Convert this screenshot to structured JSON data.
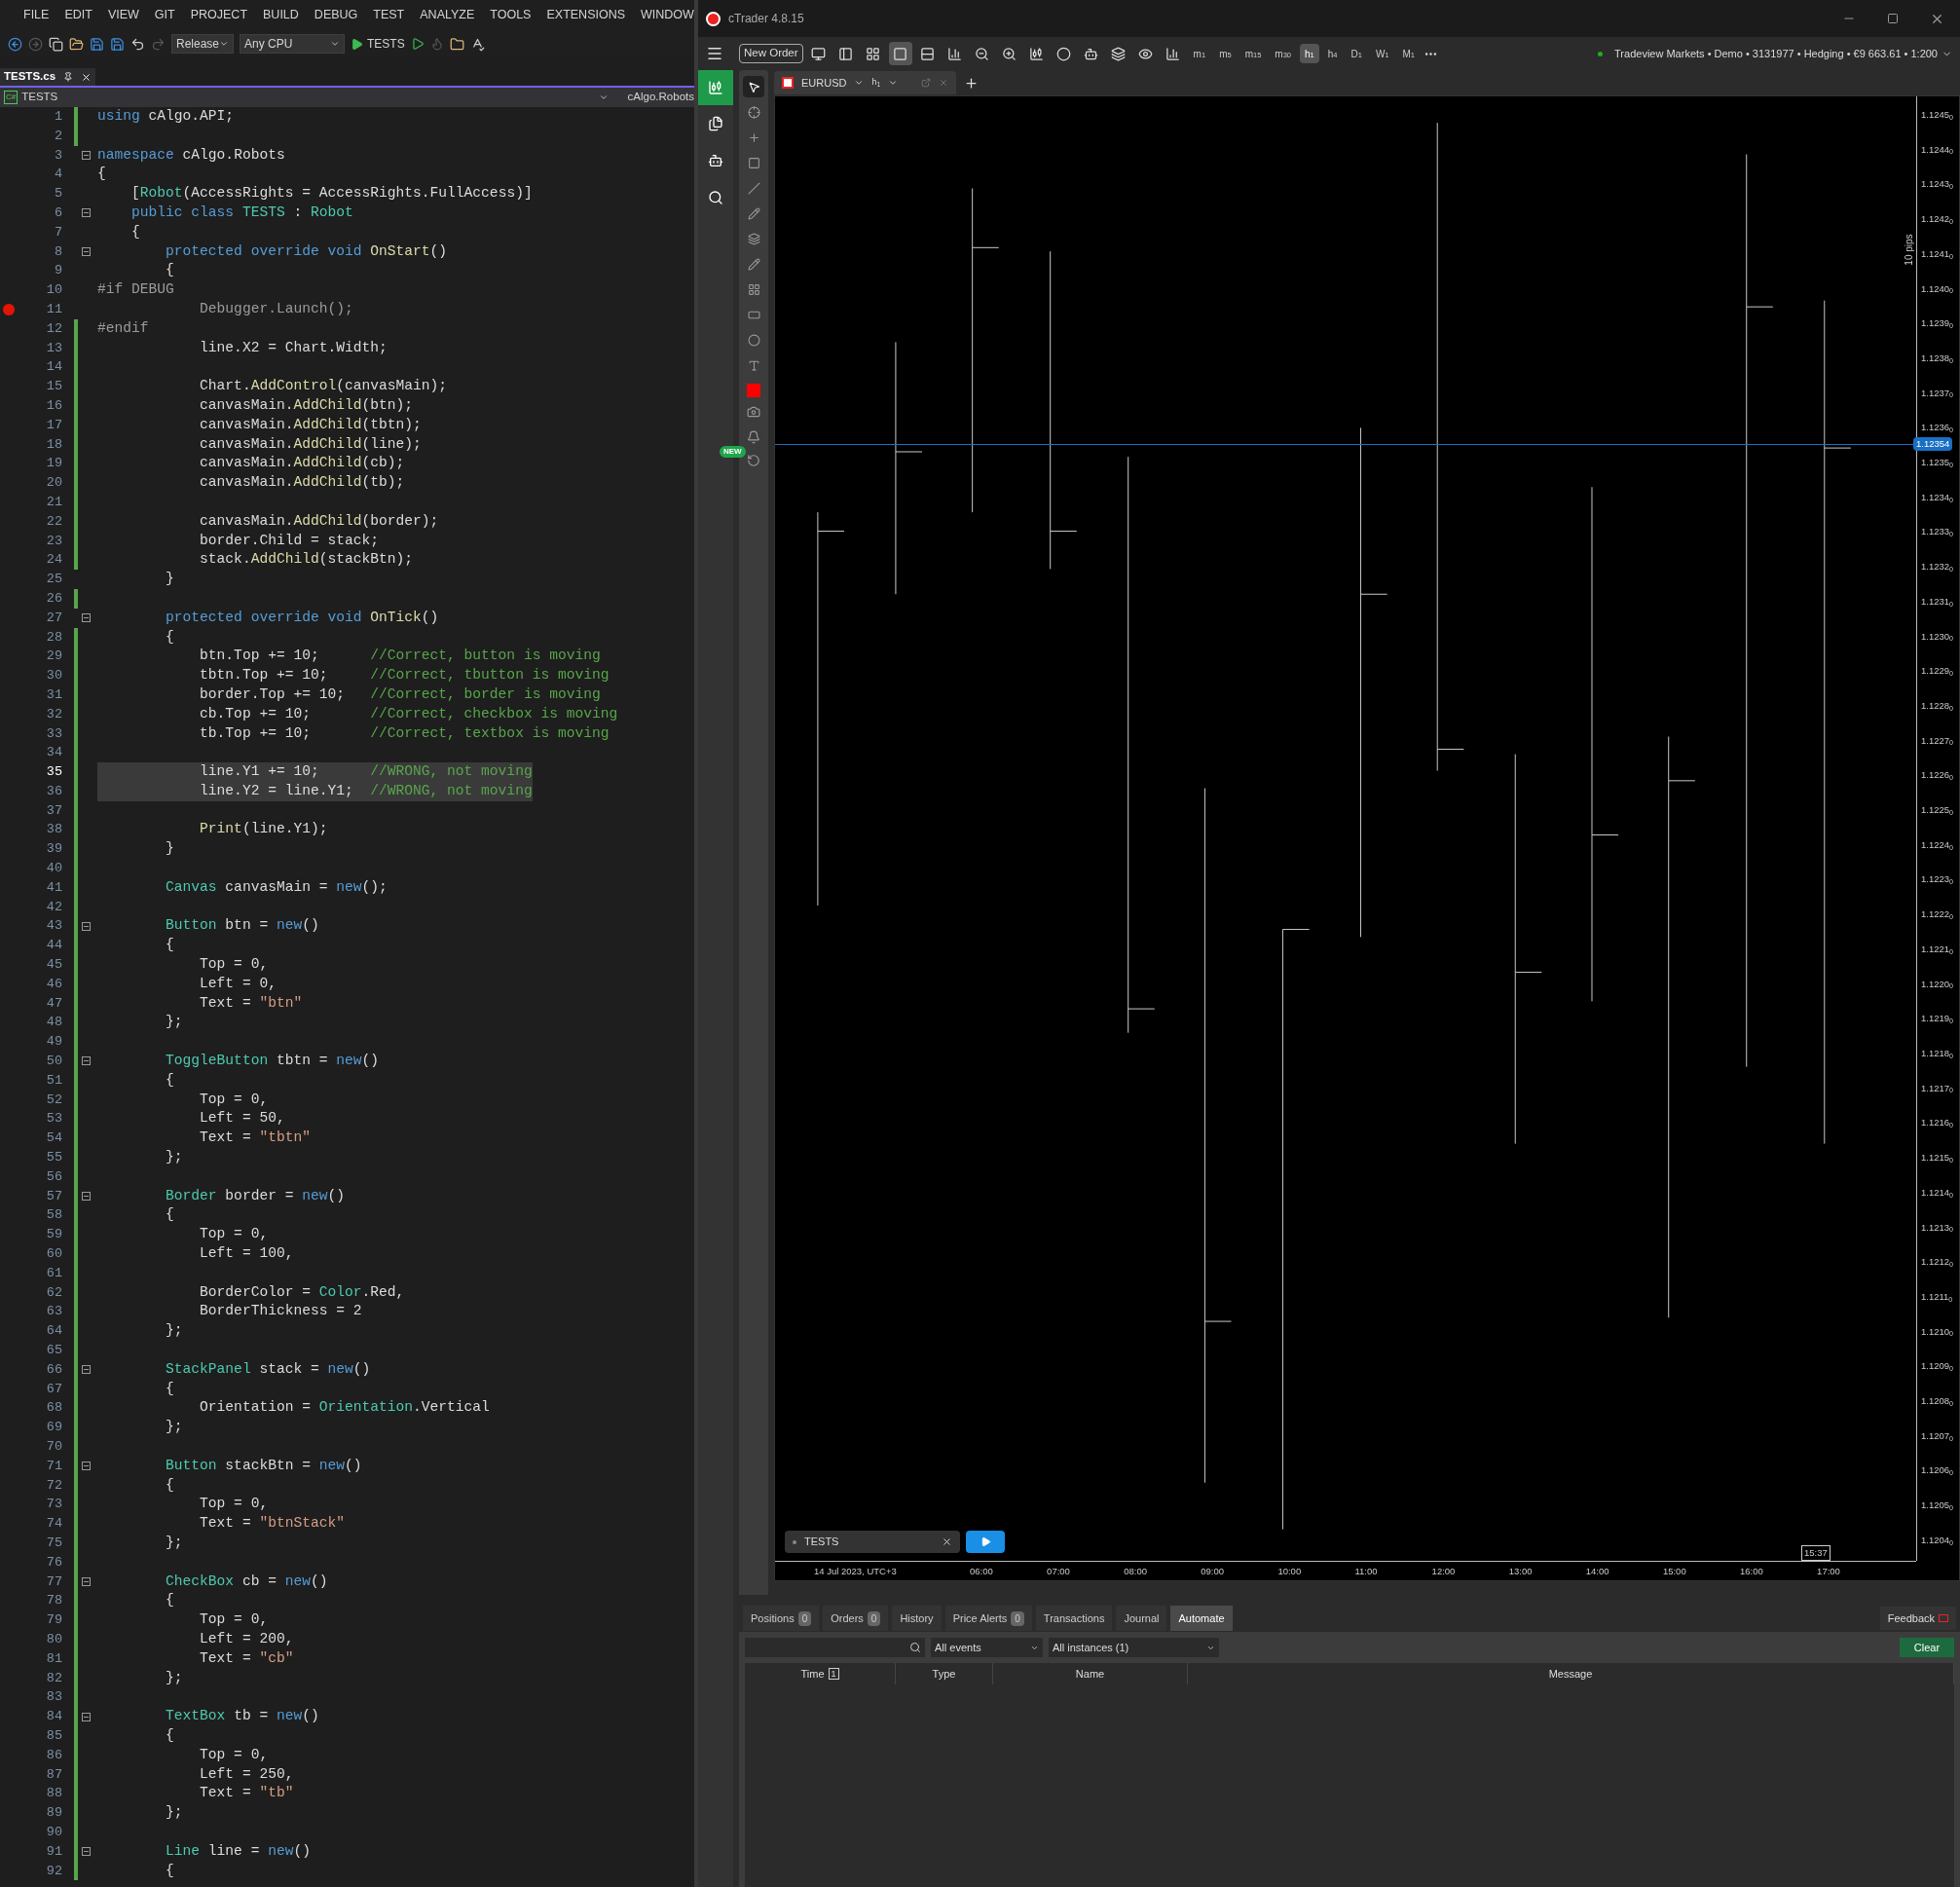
{
  "ide": {
    "menu": [
      "FILE",
      "EDIT",
      "VIEW",
      "GIT",
      "PROJECT",
      "BUILD",
      "DEBUG",
      "TEST",
      "ANALYZE",
      "TOOLS",
      "EXTENSIONS",
      "WINDOW"
    ],
    "toolbar": {
      "configuration": "Release",
      "platform": "Any CPU",
      "start": "TESTS"
    },
    "tab": {
      "label": "TESTS.cs",
      "selected": true
    },
    "nav": {
      "language": "C#",
      "project": "TESTS",
      "scope": "cAlgo.Robots"
    },
    "lines": [
      {
        "number": "1",
        "changed": true,
        "tokens": [
          {
            "kind": "kw",
            "text": "using"
          },
          {
            "kind": "plain",
            "text": " cAlgo.API;"
          }
        ]
      },
      {
        "number": "2",
        "changed": true
      },
      {
        "number": "3",
        "fold": true,
        "tokens": [
          {
            "kind": "kw",
            "text": "namespace"
          },
          {
            "kind": "plain",
            "text": " cAlgo.Robots"
          }
        ]
      },
      {
        "number": "4",
        "tokens": [
          {
            "kind": "plain",
            "text": "{"
          }
        ]
      },
      {
        "number": "5",
        "tokens": [
          {
            "kind": "plain",
            "text": "    ["
          },
          {
            "kind": "type",
            "text": "Robot"
          },
          {
            "kind": "plain",
            "text": "(AccessRights = AccessRights.FullAccess)]"
          }
        ]
      },
      {
        "number": "6",
        "fold": true,
        "tokens": [
          {
            "kind": "kw",
            "text": "    public class"
          },
          {
            "kind": "type",
            "text": " TESTS"
          },
          {
            "kind": "plain",
            "text": " : "
          },
          {
            "kind": "type",
            "text": "Robot"
          }
        ]
      },
      {
        "number": "7",
        "tokens": [
          {
            "kind": "plain",
            "text": "    {"
          }
        ]
      },
      {
        "number": "8",
        "fold": true,
        "tokens": [
          {
            "kind": "kw",
            "text": "        protected override void"
          },
          {
            "kind": "method",
            "text": " OnStart"
          },
          {
            "kind": "plain",
            "text": "()"
          }
        ]
      },
      {
        "number": "9",
        "tokens": [
          {
            "kind": "plain",
            "text": "        {"
          }
        ]
      },
      {
        "number": "10",
        "tokens": [
          {
            "kind": "inactive",
            "text": "#if DEBUG"
          }
        ]
      },
      {
        "number": "11",
        "breakpoint": true,
        "tokens": [
          {
            "kind": "inactive",
            "text": "            Debugger.Launch();"
          }
        ]
      },
      {
        "number": "12",
        "changed": true,
        "tokens": [
          {
            "kind": "inactive",
            "text": "#endif"
          }
        ]
      },
      {
        "number": "13",
        "changed": true,
        "tokens": [
          {
            "kind": "plain",
            "text": "            line.X2 = Chart.Width;"
          }
        ]
      },
      {
        "number": "14",
        "changed": true
      },
      {
        "number": "15",
        "changed": true,
        "tokens": [
          {
            "kind": "plain",
            "text": "            Chart."
          },
          {
            "kind": "method",
            "text": "AddControl"
          },
          {
            "kind": "plain",
            "text": "(canvasMain);"
          }
        ]
      },
      {
        "number": "16",
        "changed": true,
        "tokens": [
          {
            "kind": "plain",
            "text": "            canvasMain."
          },
          {
            "kind": "method",
            "text": "AddChild"
          },
          {
            "kind": "plain",
            "text": "(btn);"
          }
        ]
      },
      {
        "number": "17",
        "changed": true,
        "tokens": [
          {
            "kind": "plain",
            "text": "            canvasMain."
          },
          {
            "kind": "method",
            "text": "AddChild"
          },
          {
            "kind": "plain",
            "text": "(tbtn);"
          }
        ]
      },
      {
        "number": "18",
        "changed": true,
        "tokens": [
          {
            "kind": "plain",
            "text": "            canvasMain."
          },
          {
            "kind": "method",
            "text": "AddChild"
          },
          {
            "kind": "plain",
            "text": "(line);"
          }
        ]
      },
      {
        "number": "19",
        "changed": true,
        "tokens": [
          {
            "kind": "plain",
            "text": "            canvasMain."
          },
          {
            "kind": "method",
            "text": "AddChild"
          },
          {
            "kind": "plain",
            "text": "(cb);"
          }
        ]
      },
      {
        "number": "20",
        "changed": true,
        "tokens": [
          {
            "kind": "plain",
            "text": "            canvasMain."
          },
          {
            "kind": "method",
            "text": "AddChild"
          },
          {
            "kind": "plain",
            "text": "(tb);"
          }
        ]
      },
      {
        "number": "21",
        "changed": true
      },
      {
        "number": "22",
        "changed": true,
        "tokens": [
          {
            "kind": "plain",
            "text": "            canvasMain."
          },
          {
            "kind": "method",
            "text": "AddChild"
          },
          {
            "kind": "plain",
            "text": "(border);"
          }
        ]
      },
      {
        "number": "23",
        "changed": true,
        "tokens": [
          {
            "kind": "plain",
            "text": "            border.Child = stack;"
          }
        ]
      },
      {
        "number": "24",
        "changed": true,
        "tokens": [
          {
            "kind": "plain",
            "text": "            stack."
          },
          {
            "kind": "method",
            "text": "AddChild"
          },
          {
            "kind": "plain",
            "text": "(stackBtn);"
          }
        ]
      },
      {
        "number": "25",
        "tokens": [
          {
            "kind": "plain",
            "text": "        }"
          }
        ]
      },
      {
        "number": "26",
        "changed": true
      },
      {
        "number": "27",
        "fold": true,
        "tokens": [
          {
            "kind": "kw",
            "text": "        protected override void"
          },
          {
            "kind": "method",
            "text": " OnTick"
          },
          {
            "kind": "plain",
            "text": "()"
          }
        ]
      },
      {
        "number": "28",
        "changed": true,
        "tokens": [
          {
            "kind": "plain",
            "text": "        {"
          }
        ]
      },
      {
        "number": "29",
        "changed": true,
        "tokens": [
          {
            "kind": "plain",
            "text": "            btn.Top += 10;      "
          },
          {
            "kind": "comment",
            "text": "//Correct, button is moving"
          }
        ]
      },
      {
        "number": "30",
        "changed": true,
        "tokens": [
          {
            "kind": "plain",
            "text": "            tbtn.Top += 10;     "
          },
          {
            "kind": "comment",
            "text": "//Correct, tbutton is moving"
          }
        ]
      },
      {
        "number": "31",
        "changed": true,
        "tokens": [
          {
            "kind": "plain",
            "text": "            border.Top += 10;   "
          },
          {
            "kind": "comment",
            "text": "//Correct, border is moving"
          }
        ]
      },
      {
        "number": "32",
        "changed": true,
        "tokens": [
          {
            "kind": "plain",
            "text": "            cb.Top += 10;       "
          },
          {
            "kind": "comment",
            "text": "//Correct, checkbox is moving"
          }
        ]
      },
      {
        "number": "33",
        "changed": true,
        "tokens": [
          {
            "kind": "plain",
            "text": "            tb.Top += 10;       "
          },
          {
            "kind": "comment",
            "text": "//Correct, textbox is moving"
          }
        ]
      },
      {
        "number": "34",
        "changed": true
      },
      {
        "number": "35",
        "changed": true,
        "current": true,
        "highlighted": true,
        "tokens": [
          {
            "kind": "plain",
            "text": "            line.Y1 += 10;      "
          },
          {
            "kind": "comment",
            "text": "//WRONG, not moving"
          }
        ]
      },
      {
        "number": "36",
        "changed": true,
        "highlighted": true,
        "tokens": [
          {
            "kind": "plain",
            "text": "            line.Y2 = line.Y1;  "
          },
          {
            "kind": "comment",
            "text": "//WRONG, not moving"
          }
        ]
      },
      {
        "number": "37",
        "changed": true
      },
      {
        "number": "38",
        "changed": true,
        "tokens": [
          {
            "kind": "method",
            "text": "            Print"
          },
          {
            "kind": "plain",
            "text": "(line.Y1);"
          }
        ]
      },
      {
        "number": "39",
        "changed": true,
        "tokens": [
          {
            "kind": "plain",
            "text": "        }"
          }
        ]
      },
      {
        "number": "40",
        "changed": true
      },
      {
        "number": "41",
        "changed": true,
        "tokens": [
          {
            "kind": "type",
            "text": "        Canvas"
          },
          {
            "kind": "plain",
            "text": " canvasMain = "
          },
          {
            "kind": "kw",
            "text": "new"
          },
          {
            "kind": "plain",
            "text": "();"
          }
        ]
      },
      {
        "number": "42",
        "changed": true
      },
      {
        "number": "43",
        "changed": true,
        "fold": true,
        "tokens": [
          {
            "kind": "type",
            "text": "        Button"
          },
          {
            "kind": "plain",
            "text": " btn = "
          },
          {
            "kind": "kw",
            "text": "new"
          },
          {
            "kind": "plain",
            "text": "()"
          }
        ]
      },
      {
        "number": "44",
        "changed": true,
        "tokens": [
          {
            "kind": "plain",
            "text": "        {"
          }
        ]
      },
      {
        "number": "45",
        "changed": true,
        "tokens": [
          {
            "kind": "plain",
            "text": "            Top = 0,"
          }
        ]
      },
      {
        "number": "46",
        "changed": true,
        "tokens": [
          {
            "kind": "plain",
            "text": "            Left = 0,"
          }
        ]
      },
      {
        "number": "47",
        "changed": true,
        "tokens": [
          {
            "kind": "plain",
            "text": "            Text = "
          },
          {
            "kind": "string",
            "text": "\"btn\""
          }
        ]
      },
      {
        "number": "48",
        "changed": true,
        "tokens": [
          {
            "kind": "plain",
            "text": "        };"
          }
        ]
      },
      {
        "number": "49",
        "changed": true
      },
      {
        "number": "50",
        "changed": true,
        "fold": true,
        "tokens": [
          {
            "kind": "type",
            "text": "        ToggleButton"
          },
          {
            "kind": "plain",
            "text": " tbtn = "
          },
          {
            "kind": "kw",
            "text": "new"
          },
          {
            "kind": "plain",
            "text": "()"
          }
        ]
      },
      {
        "number": "51",
        "changed": true,
        "tokens": [
          {
            "kind": "plain",
            "text": "        {"
          }
        ]
      },
      {
        "number": "52",
        "changed": true,
        "tokens": [
          {
            "kind": "plain",
            "text": "            Top = 0,"
          }
        ]
      },
      {
        "number": "53",
        "changed": true,
        "tokens": [
          {
            "kind": "plain",
            "text": "            Left = 50,"
          }
        ]
      },
      {
        "number": "54",
        "changed": true,
        "tokens": [
          {
            "kind": "plain",
            "text": "            Text = "
          },
          {
            "kind": "string",
            "text": "\"tbtn\""
          }
        ]
      },
      {
        "number": "55",
        "changed": true,
        "tokens": [
          {
            "kind": "plain",
            "text": "        };"
          }
        ]
      },
      {
        "number": "56",
        "changed": true
      },
      {
        "number": "57",
        "changed": true,
        "fold": true,
        "tokens": [
          {
            "kind": "type",
            "text": "        Border"
          },
          {
            "kind": "plain",
            "text": " border = "
          },
          {
            "kind": "kw",
            "text": "new"
          },
          {
            "kind": "plain",
            "text": "()"
          }
        ]
      },
      {
        "number": "58",
        "changed": true,
        "tokens": [
          {
            "kind": "plain",
            "text": "        {"
          }
        ]
      },
      {
        "number": "59",
        "changed": true,
        "tokens": [
          {
            "kind": "plain",
            "text": "            Top = 0,"
          }
        ]
      },
      {
        "number": "60",
        "changed": true,
        "tokens": [
          {
            "kind": "plain",
            "text": "            Left = 100,"
          }
        ]
      },
      {
        "number": "61",
        "changed": true
      },
      {
        "number": "62",
        "changed": true,
        "tokens": [
          {
            "kind": "plain",
            "text": "            BorderColor = "
          },
          {
            "kind": "type",
            "text": "Color"
          },
          {
            "kind": "plain",
            "text": ".Red,"
          }
        ]
      },
      {
        "number": "63",
        "changed": true,
        "tokens": [
          {
            "kind": "plain",
            "text": "            BorderThickness = 2"
          }
        ]
      },
      {
        "number": "64",
        "changed": true,
        "tokens": [
          {
            "kind": "plain",
            "text": "        };"
          }
        ]
      },
      {
        "number": "65",
        "changed": true
      },
      {
        "number": "66",
        "changed": true,
        "fold": true,
        "tokens": [
          {
            "kind": "type",
            "text": "        StackPanel"
          },
          {
            "kind": "plain",
            "text": " stack = "
          },
          {
            "kind": "kw",
            "text": "new"
          },
          {
            "kind": "plain",
            "text": "()"
          }
        ]
      },
      {
        "number": "67",
        "changed": true,
        "tokens": [
          {
            "kind": "plain",
            "text": "        {"
          }
        ]
      },
      {
        "number": "68",
        "changed": true,
        "tokens": [
          {
            "kind": "plain",
            "text": "            Orientation = "
          },
          {
            "kind": "type",
            "text": "Orientation"
          },
          {
            "kind": "plain",
            "text": ".Vertical"
          }
        ]
      },
      {
        "number": "69",
        "changed": true,
        "tokens": [
          {
            "kind": "plain",
            "text": "        };"
          }
        ]
      },
      {
        "number": "70",
        "changed": true
      },
      {
        "number": "71",
        "changed": true,
        "fold": true,
        "tokens": [
          {
            "kind": "type",
            "text": "        Button"
          },
          {
            "kind": "plain",
            "text": " stackBtn = "
          },
          {
            "kind": "kw",
            "text": "new"
          },
          {
            "kind": "plain",
            "text": "()"
          }
        ]
      },
      {
        "number": "72",
        "changed": true,
        "tokens": [
          {
            "kind": "plain",
            "text": "        {"
          }
        ]
      },
      {
        "number": "73",
        "changed": true,
        "tokens": [
          {
            "kind": "plain",
            "text": "            Top = 0,"
          }
        ]
      },
      {
        "number": "74",
        "changed": true,
        "tokens": [
          {
            "kind": "plain",
            "text": "            Text = "
          },
          {
            "kind": "string",
            "text": "\"btnStack\""
          }
        ]
      },
      {
        "number": "75",
        "changed": true,
        "tokens": [
          {
            "kind": "plain",
            "text": "        };"
          }
        ]
      },
      {
        "number": "76",
        "changed": true
      },
      {
        "number": "77",
        "changed": true,
        "fold": true,
        "tokens": [
          {
            "kind": "type",
            "text": "        CheckBox"
          },
          {
            "kind": "plain",
            "text": " cb = "
          },
          {
            "kind": "kw",
            "text": "new"
          },
          {
            "kind": "plain",
            "text": "()"
          }
        ]
      },
      {
        "number": "78",
        "changed": true,
        "tokens": [
          {
            "kind": "plain",
            "text": "        {"
          }
        ]
      },
      {
        "number": "79",
        "changed": true,
        "tokens": [
          {
            "kind": "plain",
            "text": "            Top = 0,"
          }
        ]
      },
      {
        "number": "80",
        "changed": true,
        "tokens": [
          {
            "kind": "plain",
            "text": "            Left = 200,"
          }
        ]
      },
      {
        "number": "81",
        "changed": true,
        "tokens": [
          {
            "kind": "plain",
            "text": "            Text = "
          },
          {
            "kind": "string",
            "text": "\"cb\""
          }
        ]
      },
      {
        "number": "82",
        "changed": true,
        "tokens": [
          {
            "kind": "plain",
            "text": "        };"
          }
        ]
      },
      {
        "number": "83",
        "changed": true
      },
      {
        "number": "84",
        "changed": true,
        "fold": true,
        "tokens": [
          {
            "kind": "type",
            "text": "        TextBox"
          },
          {
            "kind": "plain",
            "text": " tb = "
          },
          {
            "kind": "kw",
            "text": "new"
          },
          {
            "kind": "plain",
            "text": "()"
          }
        ]
      },
      {
        "number": "85",
        "changed": true,
        "tokens": [
          {
            "kind": "plain",
            "text": "        {"
          }
        ]
      },
      {
        "number": "86",
        "changed": true,
        "tokens": [
          {
            "kind": "plain",
            "text": "            Top = 0,"
          }
        ]
      },
      {
        "number": "87",
        "changed": true,
        "tokens": [
          {
            "kind": "plain",
            "text": "            Left = 250,"
          }
        ]
      },
      {
        "number": "88",
        "changed": true,
        "tokens": [
          {
            "kind": "plain",
            "text": "            Text = "
          },
          {
            "kind": "string",
            "text": "\"tb\""
          }
        ]
      },
      {
        "number": "89",
        "changed": true,
        "tokens": [
          {
            "kind": "plain",
            "text": "        };"
          }
        ]
      },
      {
        "number": "90",
        "changed": true
      },
      {
        "number": "91",
        "changed": true,
        "fold": true,
        "tokens": [
          {
            "kind": "type",
            "text": "        Line"
          },
          {
            "kind": "plain",
            "text": " line = "
          },
          {
            "kind": "kw",
            "text": "new"
          },
          {
            "kind": "plain",
            "text": "()"
          }
        ]
      },
      {
        "number": "92",
        "changed": true,
        "tokens": [
          {
            "kind": "plain",
            "text": "        {"
          }
        ]
      }
    ]
  },
  "trader": {
    "title": "cTrader 4.8.15",
    "new_order": "New Order",
    "timeframes": [
      {
        "label": "m$_{1}$",
        "selected": false
      },
      {
        "label": "m$_{5}$",
        "selected": false
      },
      {
        "label": "m$_{15}$",
        "selected": false
      },
      {
        "label": "m$_{30}$",
        "selected": false
      },
      {
        "label": "h$_{1}$",
        "selected": true
      },
      {
        "label": "h$_{4}$",
        "selected": false
      },
      {
        "label": "D$_{1}$",
        "selected": false
      },
      {
        "label": "W$_{1}$",
        "selected": false
      },
      {
        "label": "M$_{1}$",
        "selected": false
      }
    ],
    "account": "Tradeview Markets • Demo • 3131977 • Hedging • €9 663.61 • 1:200",
    "new_badge": "NEW",
    "chart": {
      "symbol": "EURUSD",
      "timeframe": "h$_{1}$",
      "scale_note": "10 pips",
      "current_price": "1.12354",
      "price_labels": [
        "1.1245$_{0}$",
        "1.1244$_{0}$",
        "1.1243$_{0}$",
        "1.1242$_{0}$",
        "1.1241$_{0}$",
        "1.1240$_{0}$",
        "1.1239$_{0}$",
        "1.1238$_{0}$",
        "1.1237$_{0}$",
        "1.1236$_{0}$",
        "1.1235$_{0}$",
        "1.1234$_{0}$",
        "1.1233$_{0}$",
        "1.1232$_{0}$",
        "1.1231$_{0}$",
        "1.1230$_{0}$",
        "1.1229$_{0}$",
        "1.1228$_{0}$",
        "1.1227$_{0}$",
        "1.1226$_{0}$",
        "1.1225$_{0}$",
        "1.1224$_{0}$",
        "1.1223$_{0}$",
        "1.1222$_{0}$",
        "1.1221$_{0}$",
        "1.1220$_{0}$",
        "1.1219$_{0}$",
        "1.1218$_{0}$",
        "1.1217$_{0}$",
        "1.1216$_{0}$",
        "1.1215$_{0}$",
        "1.1214$_{0}$",
        "1.1213$_{0}$",
        "1.1212$_{0}$",
        "1.1211$_{0}$",
        "1.1210$_{0}$",
        "1.1209$_{0}$",
        "1.1208$_{0}$",
        "1.1207$_{0}$",
        "1.1206$_{0}$",
        "1.1205$_{0}$",
        "1.1204$_{0}$"
      ],
      "date_label": "14 Jul 2023, UTC+3",
      "time_labels": [
        "06:00",
        "07:00",
        "08:00",
        "09:00",
        "10:00",
        "11:00",
        "12:00",
        "13:00",
        "14:00",
        "15:00",
        "16:00",
        "17:00"
      ],
      "cursor_time": "15:37",
      "bot": {
        "name": "TESTS"
      }
    },
    "panel": {
      "tabs": [
        {
          "label": "Positions",
          "count": "0",
          "selected": false
        },
        {
          "label": "Orders",
          "count": "0",
          "selected": false
        },
        {
          "label": "History",
          "selected": false
        },
        {
          "label": "Price Alerts",
          "count": "0",
          "selected": false
        },
        {
          "label": "Transactions",
          "selected": false
        },
        {
          "label": "Journal",
          "selected": false
        },
        {
          "label": "Automate",
          "selected": true
        }
      ],
      "feedback": "Feedback",
      "events": "All events",
      "instances": "All instances (1)",
      "clear": "Clear",
      "columns": [
        {
          "label": "Time",
          "sort": "1"
        },
        {
          "label": "Type"
        },
        {
          "label": "Name"
        },
        {
          "label": "Message"
        }
      ]
    }
  }
}
